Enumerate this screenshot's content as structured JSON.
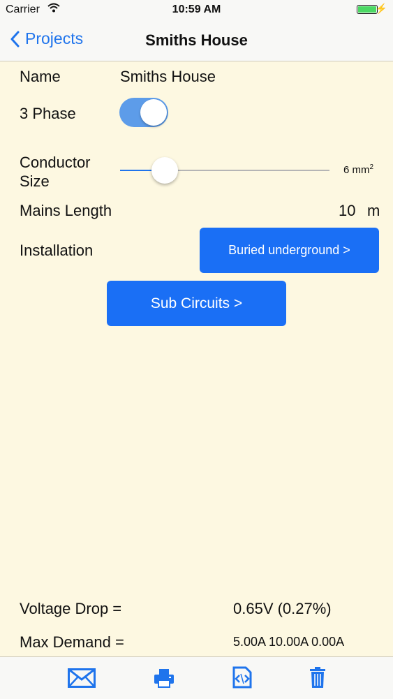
{
  "status_bar": {
    "carrier": "Carrier",
    "time": "10:59 AM",
    "icons": [
      "wifi-icon",
      "battery-icon",
      "charging-bolt-icon"
    ],
    "battery_color": "#4cd964"
  },
  "nav": {
    "back_label": "Projects",
    "title": "Smiths House",
    "accent_color": "#1f74ec"
  },
  "form": {
    "name_label": "Name",
    "name_value": "Smiths House",
    "phase_label": "3 Phase",
    "phase_on": true,
    "conductor_label_line1": "Conductor",
    "conductor_label_line2": "Size",
    "conductor_value": "6 mm",
    "conductor_unit_sup": "2",
    "conductor_slider_fraction": 0.17,
    "mains_label": "Mains Length",
    "mains_value": "10",
    "mains_unit": "m",
    "installation_label": "Installation",
    "installation_button": "Buried underground >",
    "subcircuits_button": "Sub Circuits  >"
  },
  "results": {
    "voltage_drop_label": "Voltage Drop =",
    "voltage_drop_value": "0.65V (0.27%)",
    "max_demand_label": "Max Demand =",
    "max_demand_value": "5.00A 10.00A 0.00A"
  },
  "toolbar": {
    "icons": [
      "mail-icon",
      "print-icon",
      "export-code-icon",
      "trash-icon"
    ],
    "icon_color": "#1f74ec"
  },
  "colors": {
    "background": "#fdf8e1",
    "button": "#1a6ff5",
    "toggle_on": "#5d9ce9"
  }
}
